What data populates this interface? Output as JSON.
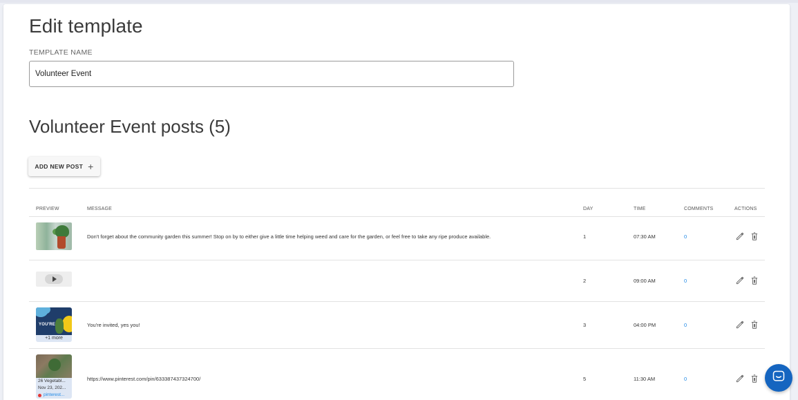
{
  "page": {
    "title": "Edit template"
  },
  "template_name": {
    "label": "TEMPLATE NAME",
    "value": "Volunteer Event"
  },
  "posts": {
    "title": "Volunteer Event posts (5)",
    "add_button_label": "ADD NEW POST",
    "add_button_icon": "plus-icon"
  },
  "table": {
    "headers": {
      "preview": "PREVIEW",
      "message": "MESSAGE",
      "day": "DAY",
      "time": "TIME",
      "comments": "COMMENTS",
      "actions": "ACTIONS"
    },
    "rows": [
      {
        "preview_type": "image",
        "message": "Don't forget about the community garden this summer! Stop on by to either give a little time helping weed and care for the garden, or feel free to take any ripe produce available.",
        "day": "1",
        "time": "07:30 AM",
        "comments": "0"
      },
      {
        "preview_type": "video",
        "message": "",
        "day": "2",
        "time": "09:00 AM",
        "comments": "0"
      },
      {
        "preview_type": "multi-image",
        "preview_image_text": "YOU'RE",
        "preview_more": "+1 more",
        "message": "You're invited, yes you!",
        "day": "3",
        "time": "04:00 PM",
        "comments": "0"
      },
      {
        "preview_type": "link",
        "preview_title": "26 Vegetabl...",
        "preview_date": "Nov 23, 202...",
        "preview_source": "pinterest...",
        "message": "https://www.pinterest.com/pin/633387437324700/",
        "day": "5",
        "time": "11:30 AM",
        "comments": "0"
      }
    ]
  },
  "icons": {
    "edit": "pencil-icon",
    "delete": "trash-icon",
    "chat": "chat-bubble-icon"
  },
  "colors": {
    "accent_link": "#1e88e5",
    "chat_button": "#1565c0"
  }
}
